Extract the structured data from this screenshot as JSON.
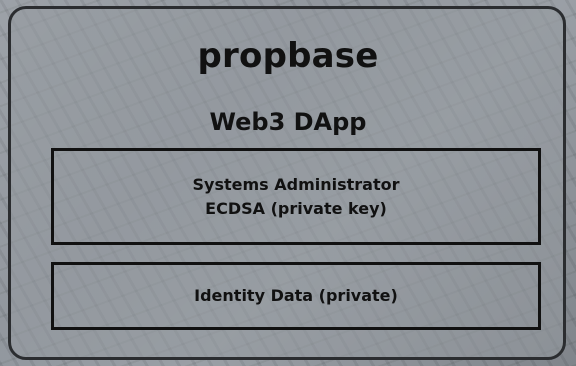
{
  "diagram": {
    "title": "propbase",
    "subtitle": "Web3 DApp",
    "admin_box": {
      "line1": "Systems Administrator",
      "line2": "ECDSA (private key)"
    },
    "identity_box": {
      "label": "Identity Data (private)"
    }
  }
}
